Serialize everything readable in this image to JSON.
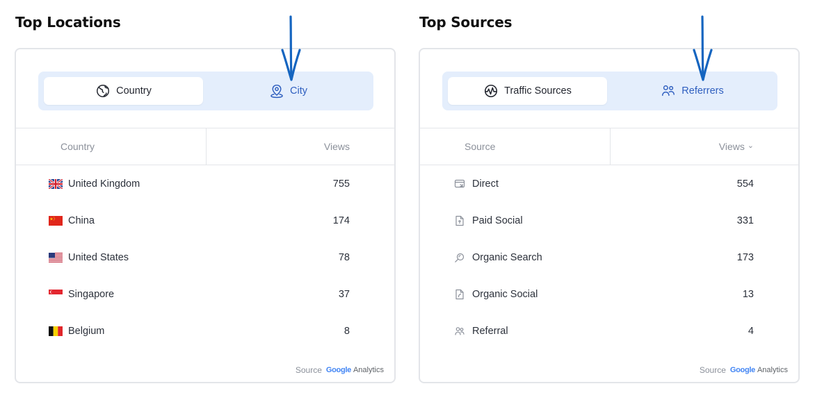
{
  "locations": {
    "title": "Top Locations",
    "toggle": {
      "active": {
        "label": "Country",
        "icon": "globe-icon"
      },
      "inactive": {
        "label": "City",
        "icon": "map-pin-icon"
      }
    },
    "columns": {
      "left": "Country",
      "right": "Views"
    },
    "rows": [
      {
        "label": "United Kingdom",
        "value": "755",
        "icon": "flag-uk-icon"
      },
      {
        "label": "China",
        "value": "174",
        "icon": "flag-china-icon"
      },
      {
        "label": "United States",
        "value": "78",
        "icon": "flag-us-icon"
      },
      {
        "label": "Singapore",
        "value": "37",
        "icon": "flag-singapore-icon"
      },
      {
        "label": "Belgium",
        "value": "8",
        "icon": "flag-belgium-icon"
      }
    ],
    "footer": {
      "source_label": "Source",
      "brand_google": "Google",
      "brand_analytics": "Analytics"
    }
  },
  "sources": {
    "title": "Top Sources",
    "toggle": {
      "active": {
        "label": "Traffic Sources",
        "icon": "traffic-icon"
      },
      "inactive": {
        "label": "Referrers",
        "icon": "users-icon"
      }
    },
    "columns": {
      "left": "Source",
      "right": "Views",
      "right_suffix": "⌄"
    },
    "rows": [
      {
        "label": "Direct",
        "value": "554",
        "icon": "direct-icon"
      },
      {
        "label": "Paid Social",
        "value": "331",
        "icon": "paid-social-icon"
      },
      {
        "label": "Organic Search",
        "value": "173",
        "icon": "organic-search-icon"
      },
      {
        "label": "Organic Social",
        "value": "13",
        "icon": "organic-social-icon"
      },
      {
        "label": "Referral",
        "value": "4",
        "icon": "referral-icon"
      }
    ],
    "footer": {
      "source_label": "Source",
      "brand_google": "Google",
      "brand_analytics": "Analytics"
    }
  },
  "colors": {
    "accent": "#2f5fbf",
    "toggle_bg": "#e4eefc",
    "annotation_arrow": "#1565c0",
    "border": "#e3e5e9"
  }
}
